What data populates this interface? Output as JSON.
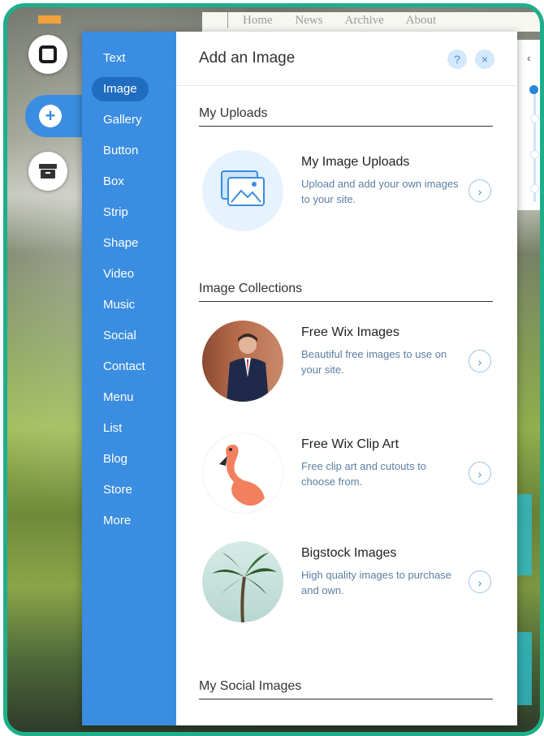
{
  "top_nav": {
    "text": "Home  News  Archive  About"
  },
  "categories": [
    "Text",
    "Image",
    "Gallery",
    "Button",
    "Box",
    "Strip",
    "Shape",
    "Video",
    "Music",
    "Social",
    "Contact",
    "Menu",
    "List",
    "Blog",
    "Store",
    "More"
  ],
  "active_category": "Image",
  "panel": {
    "title": "Add an Image",
    "help_label": "?",
    "close_label": "×",
    "sections": {
      "uploads": "My Uploads",
      "collections": "Image Collections",
      "social": "My Social Images"
    },
    "items": [
      {
        "title": "My Image Uploads",
        "desc": "Upload and add your own images to your site.",
        "arrow": "›"
      },
      {
        "title": "Free Wix Images",
        "desc": "Beautiful free images to use on your site.",
        "arrow": "›"
      },
      {
        "title": "Free Wix Clip Art",
        "desc": "Free clip art and cutouts to choose from.",
        "arrow": "›"
      },
      {
        "title": "Bigstock Images",
        "desc": "High quality images to purchase and own.",
        "arrow": "›"
      }
    ]
  },
  "right_bar": {
    "chevron": "‹"
  },
  "colors": {
    "accent": "#3a8de0",
    "frame": "#1fae8a",
    "active_category": "#1f6cc0"
  }
}
